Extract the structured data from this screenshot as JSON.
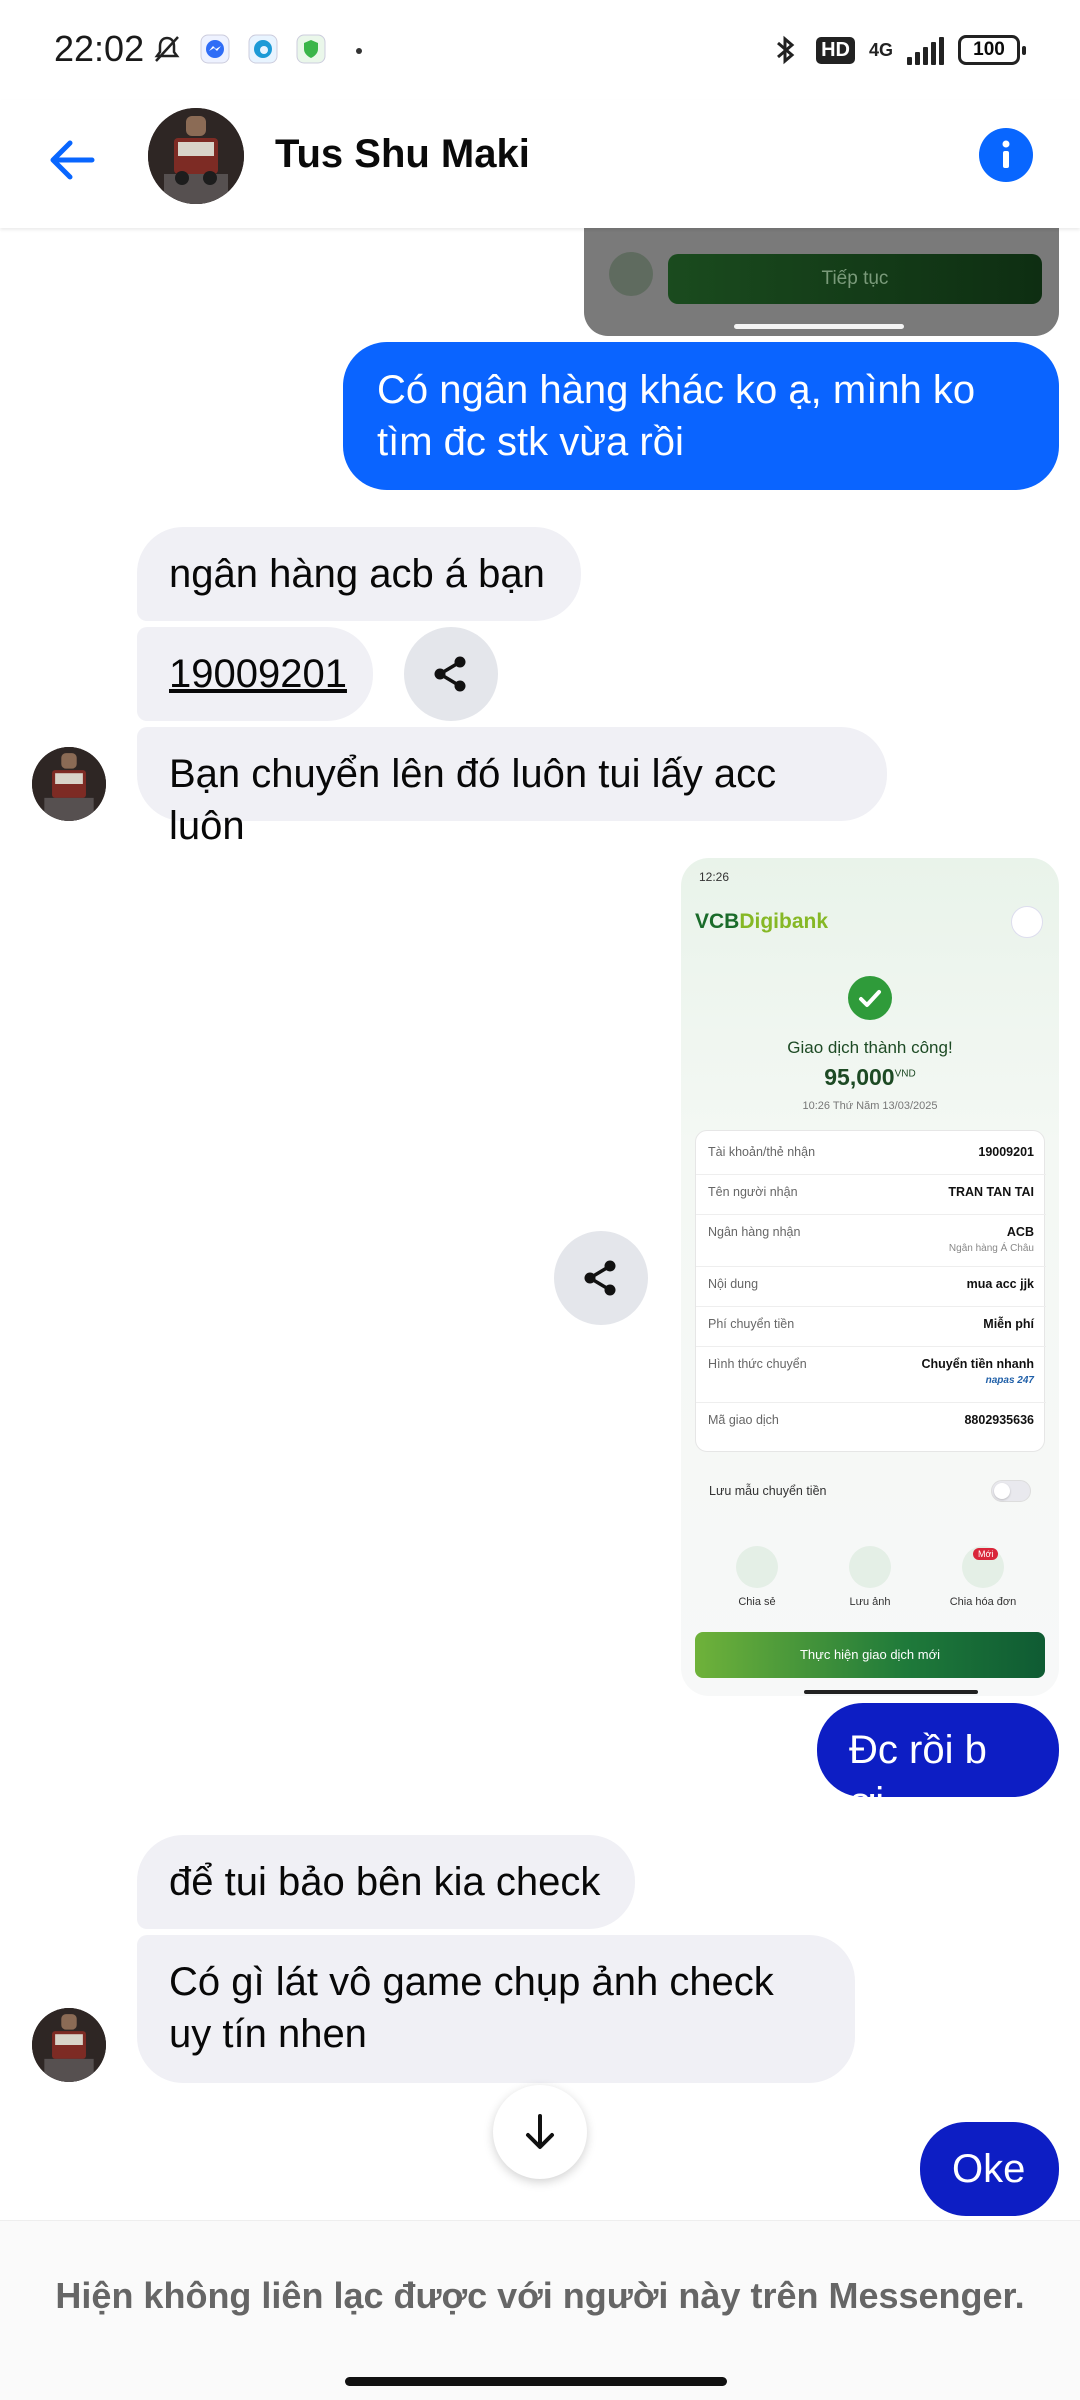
{
  "status_bar": {
    "time": "22:02",
    "network": "4G",
    "hd": "HD",
    "battery": "100"
  },
  "header": {
    "contact_name": "Tus Shu Maki",
    "back_icon": "arrow-left-icon",
    "info_icon": "info-icon",
    "accent_color": "#0866ff"
  },
  "top_image": {
    "button_label": "Tiếp tục"
  },
  "messages": [
    {
      "sender": "me",
      "text": "Có ngân hàng khác ko ạ, mình ko tìm đc stk vừa rồi"
    },
    {
      "sender": "them",
      "text": "ngân hàng acb á bạn"
    },
    {
      "sender": "them",
      "text": "19009201"
    },
    {
      "sender": "them",
      "text": "Bạn chuyển lên đó luôn tui lấy acc luôn"
    },
    {
      "sender": "me",
      "text": "Đc rồi b ơi"
    },
    {
      "sender": "them",
      "text": "để tui bảo bên kia check"
    },
    {
      "sender": "them",
      "text": "Có gì lát vô game chụp ảnh check uy tín nhen"
    },
    {
      "sender": "me",
      "text": "Oke"
    }
  ],
  "receipt": {
    "status_time": "12:26",
    "logo_part1": "VCB",
    "logo_part2": "Digibank",
    "success": "Giao dịch thành công!",
    "amount": "95,000",
    "currency": "VND",
    "datetime": "10:26 Thứ Năm 13/03/2025",
    "rows": [
      {
        "key": "Tài khoản/thẻ nhận",
        "value": "19009201"
      },
      {
        "key": "Tên người nhận",
        "value": "TRAN TAN TAI"
      },
      {
        "key": "Ngân hàng nhận",
        "value": "ACB",
        "sub": "Ngân hàng Á Châu"
      },
      {
        "key": "Nội dung",
        "value": "mua acc jjk"
      },
      {
        "key": "Phí chuyển tiền",
        "value": "Miễn phí"
      },
      {
        "key": "Hình thức chuyển",
        "value": "Chuyển tiền nhanh",
        "sub": "napas 247"
      },
      {
        "key": "Mã giao dịch",
        "value": "8802935636"
      }
    ],
    "save_template": "Lưu mẫu chuyển tiền",
    "actions": [
      {
        "label": "Chia sẻ",
        "icon": "share-icon"
      },
      {
        "label": "Lưu ảnh",
        "icon": "save-image-icon"
      },
      {
        "label": "Chia hóa đơn",
        "icon": "split-bill-icon",
        "badge": "Mới"
      }
    ],
    "new_transaction": "Thực hiện giao dịch mới"
  },
  "footer": {
    "notice": "Hiện không liên lạc được với người này trên Messenger."
  }
}
